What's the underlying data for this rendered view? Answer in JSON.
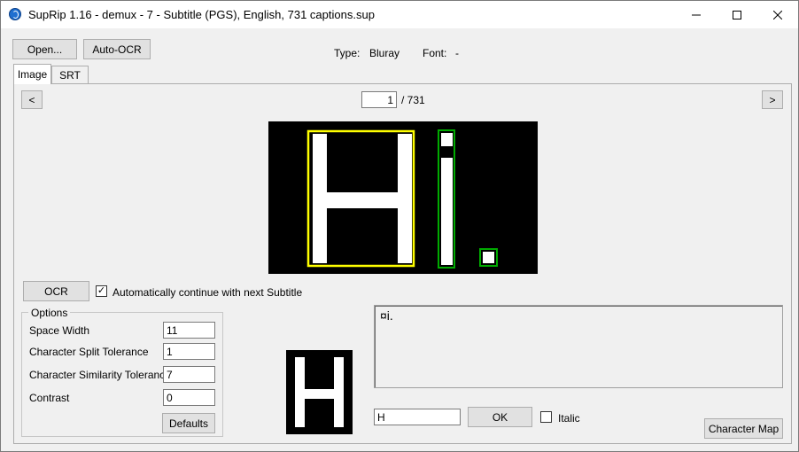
{
  "window": {
    "title": "SupRip 1.16 - demux - 7 - Subtitle (PGS), English, 731 captions.sup",
    "minimize": "—",
    "maximize": "☐",
    "close": "✕"
  },
  "toolbar": {
    "open_label": "Open...",
    "auto_ocr_label": "Auto-OCR",
    "type_label": "Type:",
    "type_value": "Bluray",
    "font_label": "Font:",
    "font_value": "-"
  },
  "tabs": [
    {
      "label": "Image",
      "active": true
    },
    {
      "label": "SRT",
      "active": false
    }
  ],
  "navigation": {
    "prev_label": "<",
    "next_label": ">",
    "current_page": "1",
    "total_label": "/ 731"
  },
  "subtitle_image": {
    "text": "Hi."
  },
  "ocr": {
    "ocr_button_label": "OCR",
    "auto_continue_checked": true,
    "auto_continue_label": "Automatically continue with next Subtitle"
  },
  "options": {
    "title": "Options",
    "space_width_label": "Space Width",
    "space_width_value": "11",
    "split_tolerance_label": "Character Split Tolerance",
    "split_tolerance_value": "1",
    "similarity_tolerance_label": "Character Similarity Tolerance",
    "similarity_tolerance_value": "7",
    "contrast_label": "Contrast",
    "contrast_value": "0",
    "defaults_label": "Defaults"
  },
  "character_preview": {
    "letter": "H"
  },
  "recognized_text": "¤i.",
  "letter_entry": {
    "value": "H",
    "ok_label": "OK",
    "italic_checked": false,
    "italic_label": "Italic"
  },
  "character_map_label": "Character Map",
  "colors": {
    "current_char_box": "#ffff00",
    "known_char_box": "#00aa00"
  }
}
